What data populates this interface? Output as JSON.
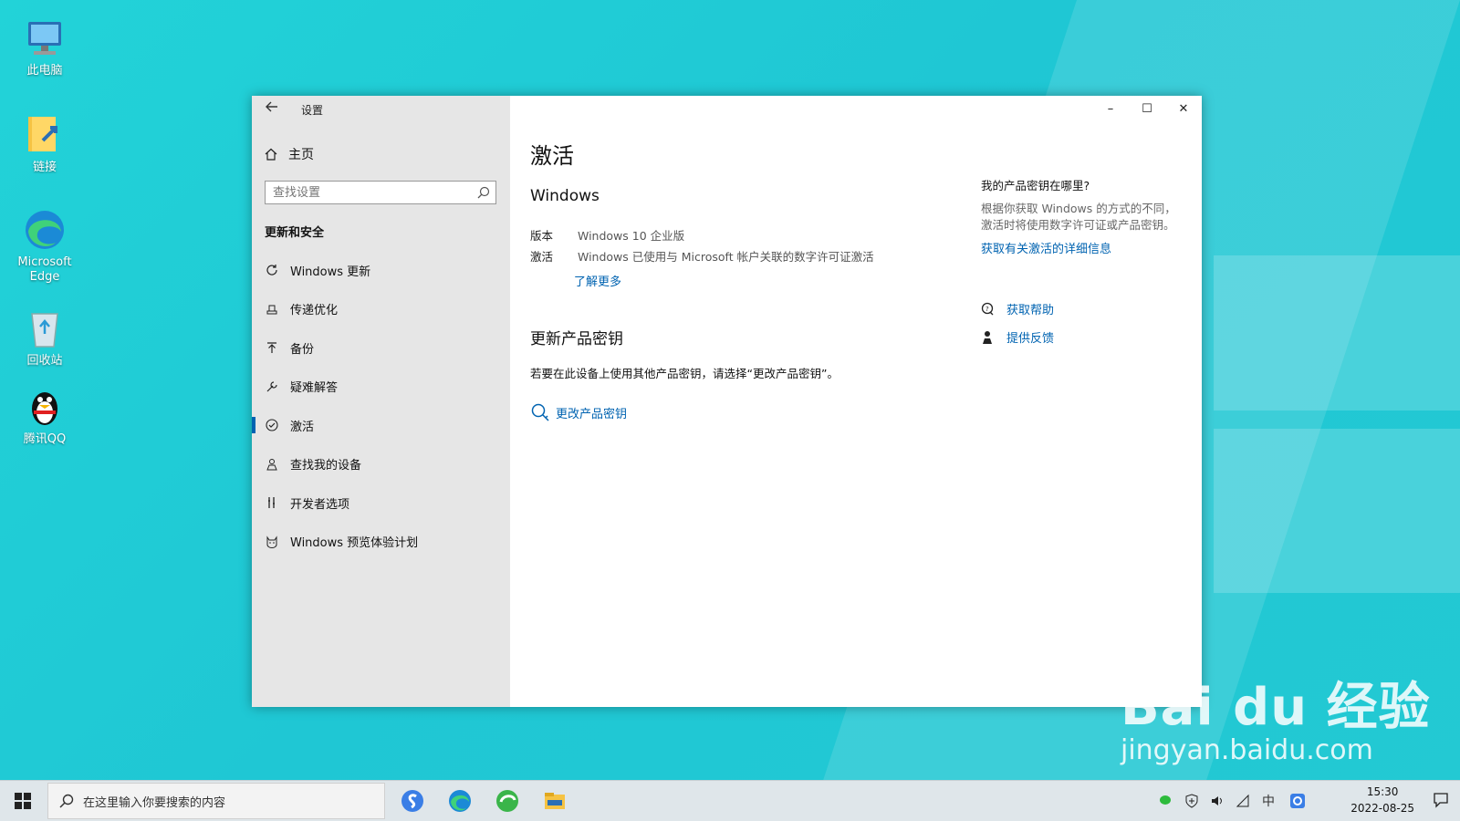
{
  "desktop_icons": [
    {
      "label": "此电脑",
      "icon": "computer-icon"
    },
    {
      "label": "链接",
      "icon": "folder-link-icon"
    },
    {
      "label": "Microsoft Edge",
      "icon": "edge-icon"
    },
    {
      "label": "回收站",
      "icon": "recycle-bin-icon"
    },
    {
      "label": "腾讯QQ",
      "icon": "qq-penguin-icon"
    }
  ],
  "window": {
    "title": "设置",
    "controls": {
      "minimize": "–",
      "maximize": "☐",
      "close": "✕"
    }
  },
  "sidebar": {
    "home_label": "主页",
    "search_placeholder": "查找设置",
    "section_title": "更新和安全",
    "items": [
      {
        "label": "Windows 更新",
        "icon": "refresh-icon"
      },
      {
        "label": "传递优化",
        "icon": "delivery-optimization-icon"
      },
      {
        "label": "备份",
        "icon": "backup-arrow-icon"
      },
      {
        "label": "疑难解答",
        "icon": "wrench-icon"
      },
      {
        "label": "激活",
        "icon": "check-circle-icon",
        "active": true
      },
      {
        "label": "查找我的设备",
        "icon": "person-locate-icon"
      },
      {
        "label": "开发者选项",
        "icon": "developer-tools-icon"
      },
      {
        "label": "Windows 预览体验计划",
        "icon": "insider-cat-icon"
      }
    ]
  },
  "main": {
    "heading": "激活",
    "windows_heading": "Windows",
    "edition_key": "版本",
    "edition_value": "Windows 10 企业版",
    "activation_key": "激活",
    "activation_value": "Windows 已使用与 Microsoft 帐户关联的数字许可证激活",
    "learn_more": "了解更多",
    "update_key_heading": "更新产品密钥",
    "update_key_desc": "若要在此设备上使用其他产品密钥，请选择“更改产品密钥”。",
    "change_key_label": "更改产品密钥"
  },
  "right_panel": {
    "question": "我的产品密钥在哪里?",
    "answer": "根据你获取 Windows 的方式的不同，激活时将使用数字许可证或产品密钥。",
    "details_link": "获取有关激活的详细信息",
    "get_help": "获取帮助",
    "feedback": "提供反馈"
  },
  "taskbar": {
    "search_placeholder": "在这里输入你要搜索的内容",
    "time": "15:30",
    "date": "2022-08-25",
    "ime": "中",
    "apps": [
      "sogou-icon",
      "edge-icon",
      "browser-360-icon",
      "file-explorer-icon"
    ]
  },
  "watermark": {
    "brand": "Bai du 经验",
    "url": "jingyan.baidu.com"
  },
  "colors": {
    "accent": "#0063b1",
    "desktop": "#22d3d8",
    "sidebar": "#e6e6e6"
  }
}
